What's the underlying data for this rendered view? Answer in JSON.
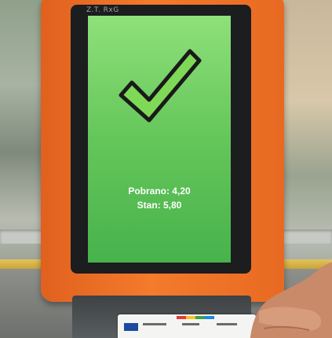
{
  "screen": {
    "status_text": "Z.T. RxG",
    "icon": "checkmark-icon",
    "collected_line": "Pobrano: 4,20",
    "balance_line": "Stan: 5,80"
  },
  "colors": {
    "validator_housing": "#f47a2c",
    "screen_green": "#64c65a",
    "checkmark_fill": "#7ed957",
    "checkmark_outline": "#1a1a1a"
  }
}
